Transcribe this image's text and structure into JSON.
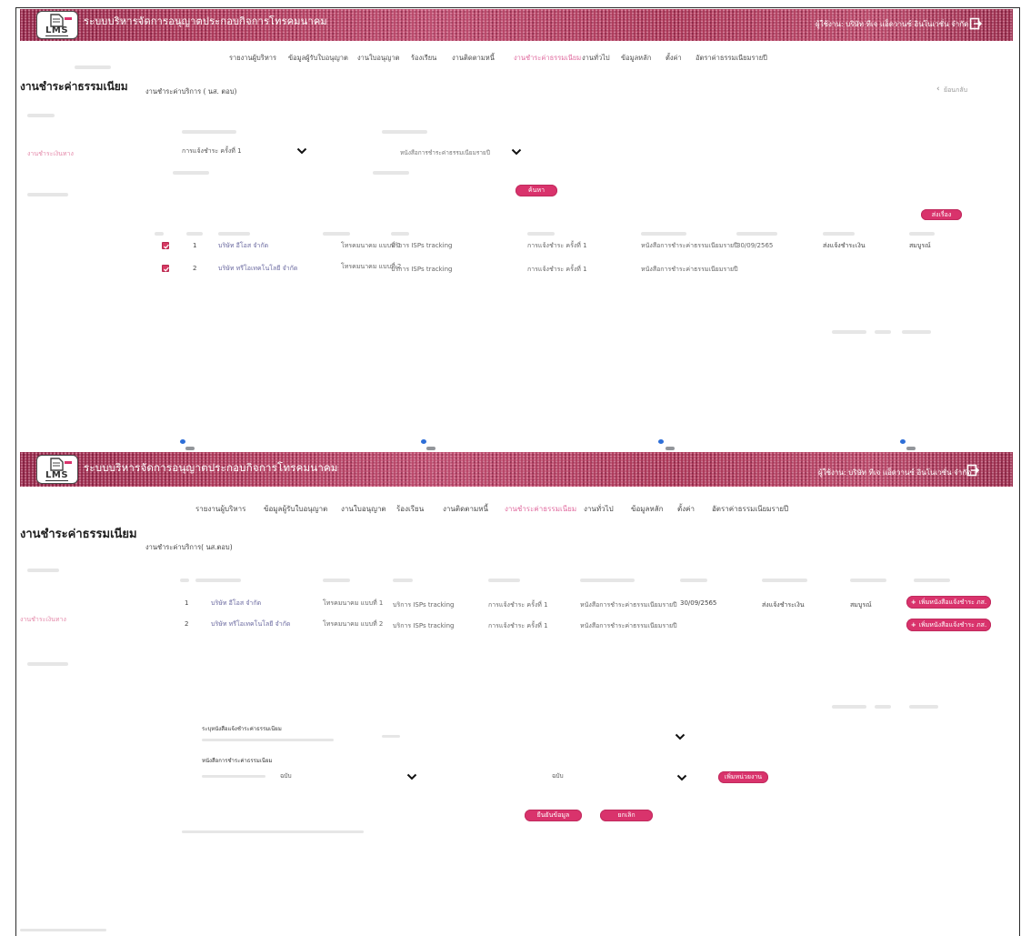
{
  "app": {
    "logo": "LMS",
    "title": "ระบบบริหารจัดการอนุญาตประกอบกิจการโทรคมนาคม",
    "user": "ผู้ใช้งาน: บริษัท ทีเจ แอ็ดวานซ์ อินโนเวชั่น จำกัด"
  },
  "nav": [
    "รายงานผู้บริหาร",
    "ข้อมูลผู้รับใบอนุญาต",
    "งานใบอนุญาต",
    "ร้องเรียน",
    "งานติดตามหนี้",
    "งานชำระค่าธรรมเนียม",
    "งานทั่วไป",
    "ข้อมูลหลัก",
    "ตั้งค่า",
    "อัตราค่าธรรมเนียมรายปี"
  ],
  "active_nav_index": 5,
  "colors": {
    "header": "#a83555",
    "accent": "#d9336c",
    "active_nav": "#e06a9e",
    "sidebar_active": "#e48aaa"
  },
  "icons": {
    "logout": "logout-icon",
    "back": "chevron-left-icon",
    "dropdown": "chevron-down-icon",
    "checkbox": "checkbox-checked-icon",
    "add": "plus-icon"
  },
  "panel1": {
    "page_title": "งานชำระค่าธรรมเนียม",
    "sidebar_item": "งานชำระเงินทาง",
    "subtitle": "งานชำระค่าบริการ ( นส. ตอบ)",
    "back_label": "ย้อนกลับ",
    "filter_job_type": "การแจ้งชำระ ครั้งที่ 1",
    "filter_document": "หนังสือการชำระค่าธรรมเนียมรายปี",
    "search_button": "ค้นหา",
    "send_button": "ส่งเรื่อง",
    "rows": [
      {
        "checked": true,
        "no": "1",
        "name": "บริษัท อีโอส จำกัด",
        "license": "โทรคมนาคม แบบที่ 1",
        "service": "บริการ ISPs tracking",
        "job": "การแจ้งชำระ ครั้งที่ 1",
        "document": "หนังสือการชำระค่าธรรมเนียมรายปี",
        "date": "30/09/2565",
        "status": "ส่งแจ้งชำระเงิน",
        "remark": "สมบูรณ์"
      },
      {
        "checked": true,
        "no": "2",
        "name": "บริษัท ทรีโอเทคโนโลยี จำกัด",
        "license": "โทรคมนาคม แบบที่ 2",
        "service": "บริการ ISPs tracking",
        "job": "การแจ้งชำระ ครั้งที่ 1",
        "document": "หนังสือการชำระค่าธรรมเนียมรายปี"
      }
    ]
  },
  "panel2": {
    "page_title": "งานชำระค่าธรรมเนียม",
    "sidebar_item": "งานชำระเงินทาง",
    "subtitle": "งานชำระค่าบริการ( นส.ตอบ)",
    "rows": [
      {
        "no": "1",
        "name": "บริษัท อีโอส จำกัด",
        "license": "โทรคมนาคม แบบที่ 1",
        "service": "บริการ ISPs tracking",
        "job": "การแจ้งชำระ ครั้งที่ 1",
        "document": "หนังสือการชำระค่าธรรมเนียมรายปี",
        "date": "30/09/2565",
        "status": "ส่งแจ้งชำระเงิน",
        "remark": "สมบูรณ์",
        "action": "เพิ่มหนังสือแจ้งชำระ ภส."
      },
      {
        "no": "2",
        "name": "บริษัท ทรีโอเทคโนโลยี จำกัด",
        "license": "โทรคมนาคม แบบที่ 2",
        "service": "บริการ ISPs tracking",
        "job": "การแจ้งชำระ ครั้งที่ 1",
        "document": "หนังสือการชำระค่าธรรมเนียมรายปี",
        "action": "เพิ่มหนังสือแจ้งชำระ ภส."
      }
    ],
    "form": {
      "notice_label": "ระบุหนังสือแจ้งชำระค่าธรรมเนียม",
      "document_label": "หนังสือการชำระค่าธรรมเนียม",
      "copies_left": "ฉบับ",
      "copies_right": "ฉบับ",
      "add_button": "เพิ่มหน่วยงาน"
    },
    "confirm_button": "ยืนยันข้อมูล",
    "cancel_button": "ยกเลิก"
  }
}
